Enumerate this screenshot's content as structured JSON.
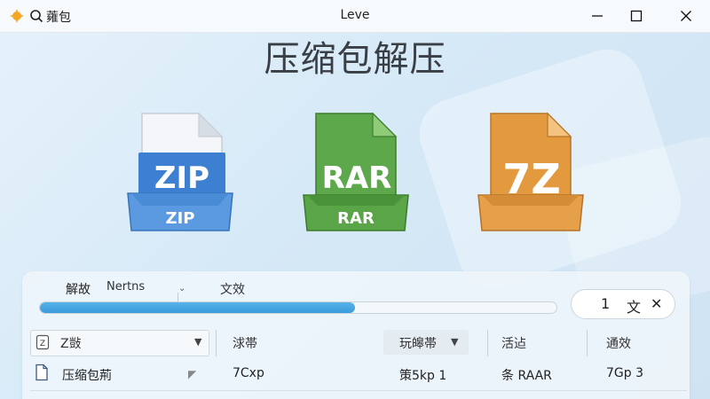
{
  "titlebar": {
    "app_name": "蕹包",
    "window_title": "Leve"
  },
  "heading": "压缩包解压",
  "file_icons": [
    {
      "name": "ZIP",
      "big_label": "ZIP",
      "small_label": "ZIP",
      "color": "#3d7fd0"
    },
    {
      "name": "RAR",
      "big_label": "RAR",
      "small_label": "RAR",
      "color": "#4c9a3c"
    },
    {
      "name": "7Z",
      "big_label": "7Z",
      "small_label": "",
      "color": "#e0983a"
    }
  ],
  "panel": {
    "tabs": [
      "解故",
      "Nertns",
      "文效"
    ],
    "progress": 0.61,
    "counter": {
      "value": "1",
      "unit": "文",
      "close_symbol": "✕"
    }
  },
  "table": {
    "columns": [
      "Z敱",
      "浗帯",
      "玩皞帯",
      "活迠",
      "通效"
    ],
    "rows": [
      {
        "name": "压缩包荊",
        "type": "7Cxp",
        "size": "策5kp 1",
        "format": "条 RAAR",
        "count": "7Gp 3"
      }
    ]
  },
  "colors": {
    "accent": "#3a9bdc",
    "zip": "#3d7fd0",
    "rar": "#4c9a3c",
    "sevenz": "#e0983a"
  },
  "icons": [
    "app-logo-icon",
    "search-icon",
    "minimize-icon",
    "maximize-icon",
    "close-icon",
    "zip-file-icon",
    "rar-file-icon",
    "7z-file-icon",
    "document-icon",
    "chevron-down-icon"
  ]
}
